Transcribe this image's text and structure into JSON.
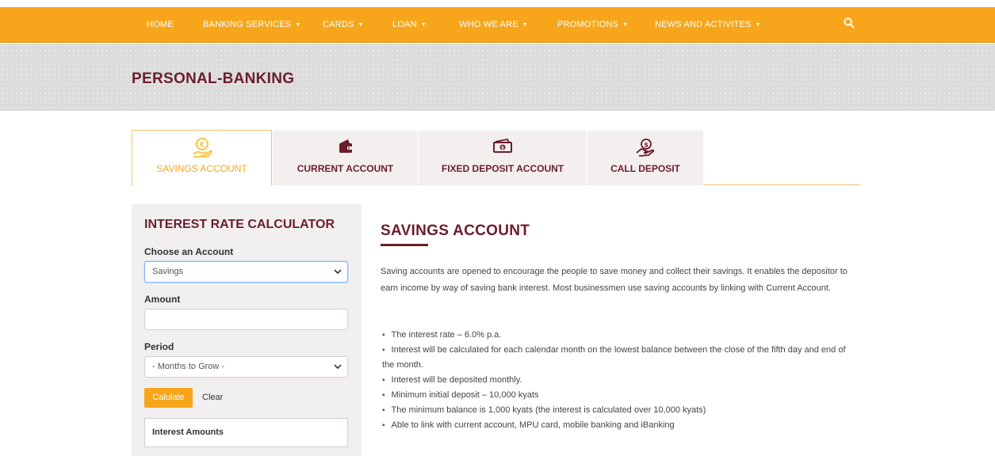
{
  "nav": {
    "items": [
      {
        "label": "HOME",
        "dropdown": false
      },
      {
        "label": "BANKING SERVICES",
        "dropdown": true
      },
      {
        "label": "CARDS",
        "dropdown": true
      },
      {
        "label": "LOAN",
        "dropdown": true
      },
      {
        "label": "WHO WE ARE",
        "dropdown": true
      },
      {
        "label": "PROMOTIONS",
        "dropdown": true
      },
      {
        "label": "NEWS AND ACTIVITES",
        "dropdown": true
      }
    ],
    "caret": "▼",
    "search_icon": "search-icon",
    "accent_color": "#f7a61b"
  },
  "banner": {
    "title": "PERSONAL-BANKING"
  },
  "tabs": [
    {
      "label": "SAVINGS ACCOUNT",
      "icon": "coin-hand-icon",
      "active": true
    },
    {
      "label": "CURRENT ACCOUNT",
      "icon": "wallet-icon",
      "active": false
    },
    {
      "label": "FIXED DEPOSIT ACCOUNT",
      "icon": "cash-icon",
      "active": false
    },
    {
      "label": "CALL DEPOSIT",
      "icon": "money-hand-icon",
      "active": false
    }
  ],
  "calculator": {
    "title": "INTEREST RATE CALCULATOR",
    "account_label": "Choose an Account",
    "account_value": "Savings",
    "amount_label": "Amount",
    "amount_value": "",
    "period_label": "Period",
    "period_value": "- Months to Grow -",
    "calculate_label": "Calulate",
    "clear_label": "Clear",
    "result_label": "Interest Amounts"
  },
  "content": {
    "title": "SAVINGS ACCOUNT",
    "paragraph": "Saving accounts are opened to encourage the people to save money and collect their savings. It enables the depositor to earn income by way of saving bank interest. Most businessmen use saving accounts by linking with Current Account.",
    "bullets": [
      "The interest rate – 6.0% p.a.",
      "Interest will be calculated for each calendar month on the lowest balance between the close of the fifth day and end of the month.",
      "Interest will be deposited monthly.",
      "Minimum initial deposit – 10,000 kyats",
      "The minimum balance is 1,000 kyats (the interest is calculated over 10,000 kyats)",
      "Able to link with current account, MPU card, mobile banking and iBanking"
    ]
  },
  "colors": {
    "brand_maroon": "#6b1d2c",
    "accent_orange": "#f7a61b"
  }
}
